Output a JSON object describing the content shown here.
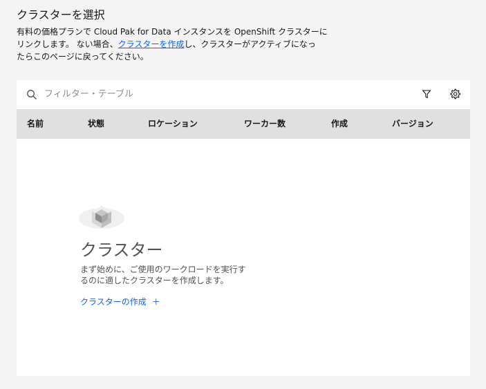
{
  "header": {
    "title": "クラスターを選択",
    "desc_line1": "有料の価格プランで Cloud Pak for Data インスタンスを OpenShift クラスターに",
    "desc_line2_before": "リンクします。 ない場合、",
    "desc_link": "クラスターを作成",
    "desc_line2_after": "し、クラスターがアクティブになっ",
    "desc_line3": "たらこのページに戻ってください。"
  },
  "toolbar": {
    "search_placeholder": "フィルター・テーブル",
    "search_icon": "search-icon",
    "filter_icon": "filter-icon",
    "settings_icon": "settings-icon"
  },
  "table": {
    "columns": [
      "名前",
      "状態",
      "ロケーション",
      "ワーカー数",
      "作成",
      "バージョン"
    ]
  },
  "empty_state": {
    "title": "クラスター",
    "desc_line1": "まず始めに、ご使用のワークロードを実行す",
    "desc_line2": "るのに適したクラスターを作成します。",
    "link_label": "クラスターの作成",
    "link_icon": "＋"
  },
  "colors": {
    "link": "#0f62fe",
    "table_header_bg": "#e0e0e0",
    "page_bg": "#f4f4f4"
  }
}
